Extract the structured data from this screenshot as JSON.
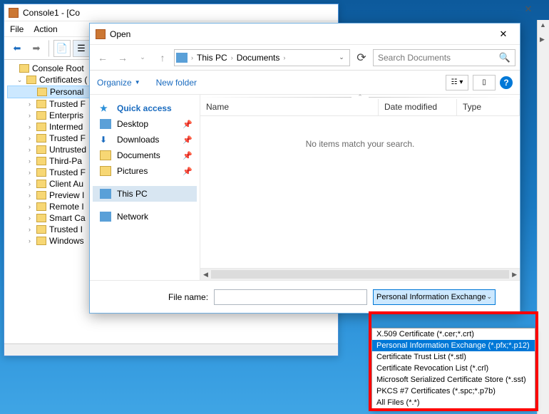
{
  "mmc": {
    "title": "Console1 - [Co",
    "menu": {
      "file": "File",
      "action": "Action"
    },
    "tree": {
      "root": "Console Root",
      "certs": "Certificates (",
      "items": [
        "Personal",
        "Trusted F",
        "Enterpris",
        "Intermed",
        "Trusted F",
        "Untrusted",
        "Third-Pa",
        "Trusted F",
        "Client Au",
        "Preview I",
        "Remote I",
        "Smart Ca",
        "Trusted I",
        "Windows"
      ]
    }
  },
  "open": {
    "title": "Open",
    "breadcrumb": {
      "root": "This PC",
      "folder": "Documents"
    },
    "search_placeholder": "Search Documents",
    "toolbar": {
      "organize": "Organize",
      "newfolder": "New folder"
    },
    "columns": {
      "name": "Name",
      "date": "Date modified",
      "type": "Type"
    },
    "empty_msg": "No items match your search.",
    "places": {
      "quick": "Quick access",
      "desktop": "Desktop",
      "downloads": "Downloads",
      "documents": "Documents",
      "pictures": "Pictures",
      "thispc": "This PC",
      "network": "Network"
    },
    "filename_label": "File name:",
    "filetype_selected": "Personal Information Exchange",
    "filetype_options": [
      "X.509 Certificate (*.cer;*.crt)",
      "Personal Information Exchange (*.pfx;*.p12)",
      "Certificate Trust List (*.stl)",
      "Certificate Revocation List (*.crl)",
      "Microsoft Serialized Certificate Store (*.sst)",
      "PKCS #7 Certificates (*.spc;*.p7b)",
      "All Files (*.*)"
    ]
  }
}
